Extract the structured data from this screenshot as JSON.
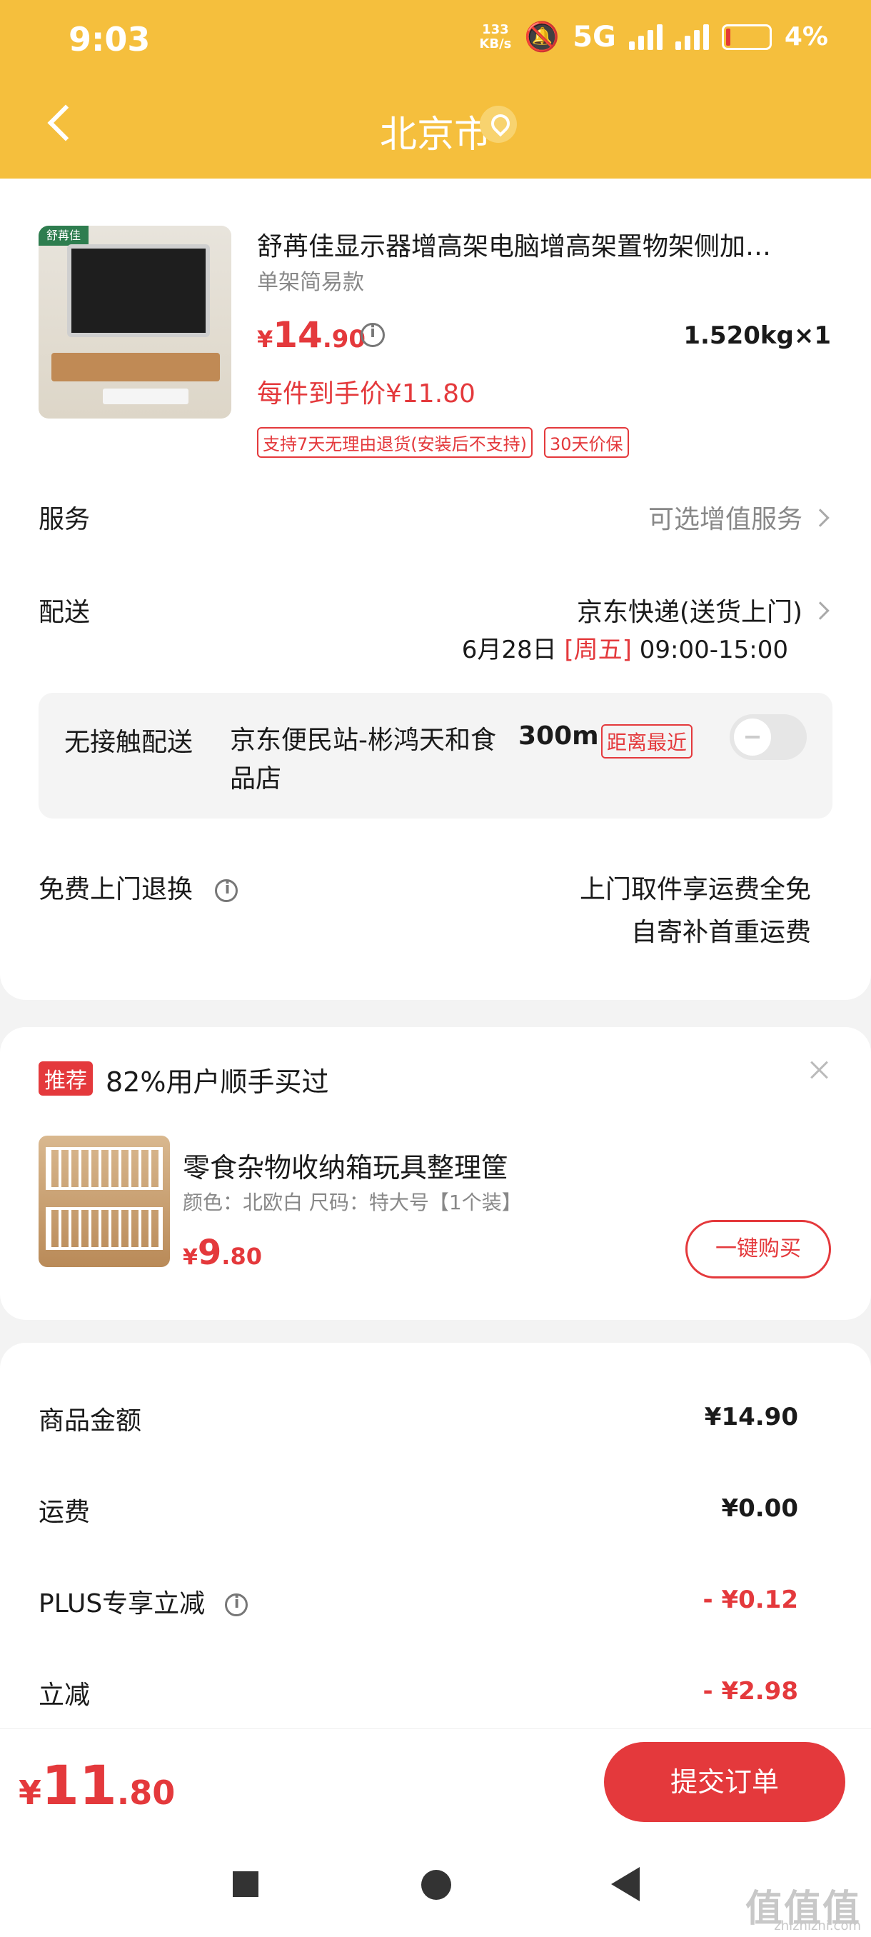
{
  "status_bar": {
    "time": "9:03",
    "net_speed_value": "133",
    "net_speed_unit": "KB/s",
    "network": "5G",
    "battery": "4%"
  },
  "header": {
    "title": "北京市"
  },
  "product": {
    "brand": "舒苒佳",
    "title": "舒苒佳显示器增高架电脑增高架置物架侧加…",
    "spec": "单架简易款",
    "price_yen": "¥",
    "price_int": "14",
    "price_dec": ".90",
    "weight_qty": "1.520kg×1",
    "final_price": "每件到手价¥11.80",
    "tags": [
      "支持7天无理由退货(安装后不支持)",
      "30天价保"
    ]
  },
  "service": {
    "label": "服务",
    "value": "可选增值服务"
  },
  "delivery": {
    "label": "配送",
    "method": "京东快递(送货上门)",
    "date": "6月28日",
    "weekday": "[周五]",
    "window": "09:00-15:00"
  },
  "contactless": {
    "label": "无接触配送",
    "station": "京东便民站-彬鸿天和食品店",
    "distance": "300m",
    "tag": "距离最近",
    "enabled": false
  },
  "return": {
    "label": "免费上门退换",
    "line1": "上门取件享运费全免",
    "line2": "自寄补首重运费"
  },
  "recommend": {
    "badge": "推荐",
    "title": "82%用户顺手买过",
    "item_name": "零食杂物收纳箱玩具整理筐",
    "item_spec": "颜色：北欧白    尺码：特大号【1个装】",
    "price_yen": "¥",
    "price_int": "9",
    "price_dec": ".80",
    "buy_label": "一键购买"
  },
  "summary": [
    {
      "label": "商品金额",
      "value": "¥14.90"
    },
    {
      "label": "运费",
      "value": "¥0.00"
    },
    {
      "label": "PLUS专享立减",
      "value": "- ¥0.12"
    },
    {
      "label": "立减",
      "value": "- ¥2.98"
    }
  ],
  "bottom": {
    "total_yen": "¥",
    "total_int": "11",
    "total_dec": ".80",
    "submit_label": "提交订单"
  },
  "watermark": {
    "main": "值值值",
    "sub": "zhizhizhi.com"
  },
  "colors": {
    "header": "#f5bf3d",
    "accent_red": "#e4393c"
  }
}
